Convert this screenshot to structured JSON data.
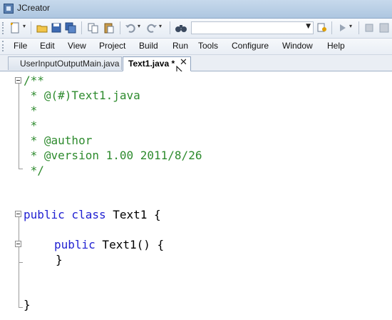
{
  "window": {
    "title": "JCreator",
    "app_icon": "jcreator-icon"
  },
  "toolbar": {
    "buttons": [
      "new-file-icon",
      "open-folder-icon",
      "save-icon",
      "save-all-icon",
      "copy-icon",
      "paste-icon",
      "undo-icon",
      "redo-icon",
      "find-binoculars-icon",
      "find-in-files-icon",
      "run-icon",
      "stop-icon",
      "build-icon"
    ],
    "search_value": ""
  },
  "menu": [
    "File",
    "Edit",
    "View",
    "Project",
    "Build",
    "Run",
    "Tools",
    "Configure",
    "Window",
    "Help"
  ],
  "tabs": [
    {
      "label": "UserInputOutputMain.java",
      "active": false
    },
    {
      "label": "Text1.java *",
      "active": true
    }
  ],
  "tab_close": "✕",
  "code": {
    "l1": "/**",
    "l2": " * @(#)Text1.java",
    "l3": " *",
    "l4": " *",
    "l5": " * @author",
    "l6": " * @version 1.00 2011/8/26",
    "l7": " */",
    "l8_kw": "public class",
    "l8_rest": " Text1 {",
    "l9_kw": "public",
    "l9_rest": " Text1() {",
    "l10": "}",
    "l11": "}"
  },
  "colors": {
    "comment": "#2e8b2e",
    "keyword": "#1f1fd1"
  }
}
